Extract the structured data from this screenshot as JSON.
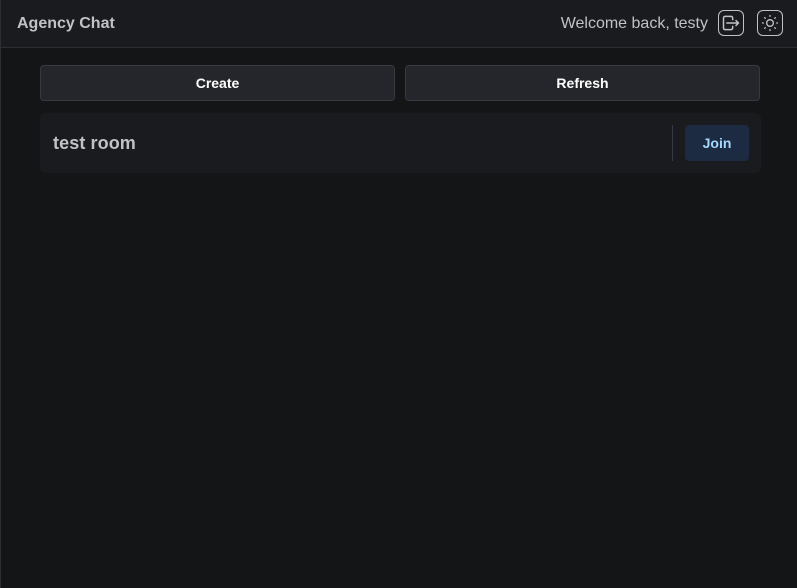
{
  "header": {
    "title": "Agency Chat",
    "welcome": "Welcome back, testy",
    "logout_icon": "logout-icon",
    "theme_icon": "sun-icon"
  },
  "actions": {
    "create_label": "Create",
    "refresh_label": "Refresh"
  },
  "rooms": [
    {
      "name": "test room",
      "join_label": "Join"
    }
  ],
  "colors": {
    "background": "#141517",
    "header": "#1a1b1e",
    "button": "#25262b",
    "join_bg": "#1c2b41",
    "join_text": "#a5d8ff"
  }
}
